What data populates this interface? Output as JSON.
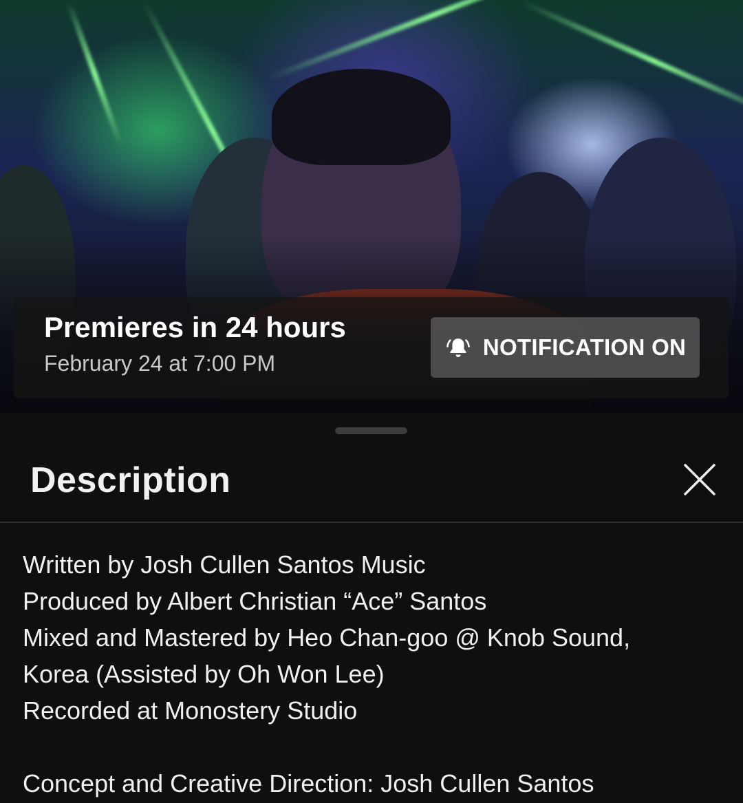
{
  "premiere": {
    "title": "Premieres in 24 hours",
    "time": "February 24 at 7:00 PM",
    "notification_label": "NOTIFICATION ON"
  },
  "sheet": {
    "title": "Description"
  },
  "description": {
    "lines": [
      "Written by Josh Cullen Santos Music",
      "Produced by Albert Christian “Ace” Santos",
      "Mixed and Mastered by Heo Chan-goo @ Knob Sound,",
      "Korea (Assisted by Oh Won Lee)",
      "Recorded at Monostery Studio",
      "",
      "Concept and Creative Direction: Josh Cullen Santos"
    ]
  },
  "colors": {
    "background": "#0f0f0f",
    "text_primary": "#f1f1f1",
    "text_secondary": "#c9c9c9"
  },
  "icons": {
    "bell": "bell-ringing-icon",
    "close": "close-icon"
  }
}
